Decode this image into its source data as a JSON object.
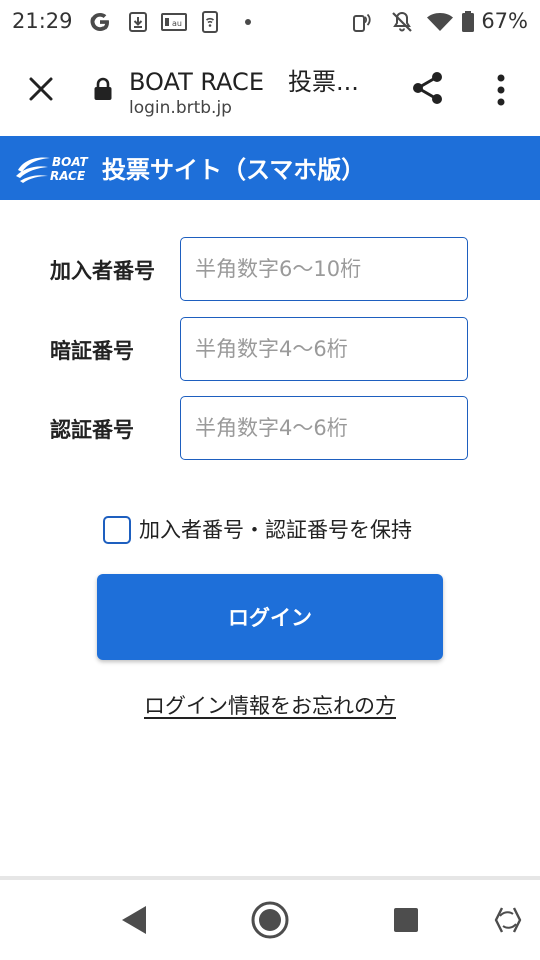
{
  "status_bar": {
    "time": "21:29",
    "battery_percent": "67%",
    "icons": [
      "google-icon",
      "download-icon",
      "au-icon",
      "wifi-calling-icon",
      "dot-icon",
      "nfc-icon",
      "mute-icon",
      "wifi-icon",
      "battery-icon"
    ]
  },
  "browser": {
    "title": "BOAT RACE　投票...",
    "url": "login.brtb.jp"
  },
  "site": {
    "brand_line1": "BOAT",
    "brand_line2": "RACE",
    "header_title": "投票サイト（スマホ版）",
    "accent_color": "#1e6fd9"
  },
  "form": {
    "member_number": {
      "label": "加入者番号",
      "placeholder": "半角数字6〜10桁",
      "value": ""
    },
    "pin": {
      "label": "暗証番号",
      "placeholder": "半角数字4〜6桁",
      "value": ""
    },
    "auth_number": {
      "label": "認証番号",
      "placeholder": "半角数字4〜6桁",
      "value": ""
    },
    "remember_label": "加入者番号・認証番号を保持",
    "remember_checked": false,
    "login_label": "ログイン",
    "forgot_label": "ログイン情報をお忘れの方"
  },
  "nav": {
    "icons": [
      "back-icon",
      "home-icon",
      "recents-icon",
      "rotate-icon"
    ]
  }
}
